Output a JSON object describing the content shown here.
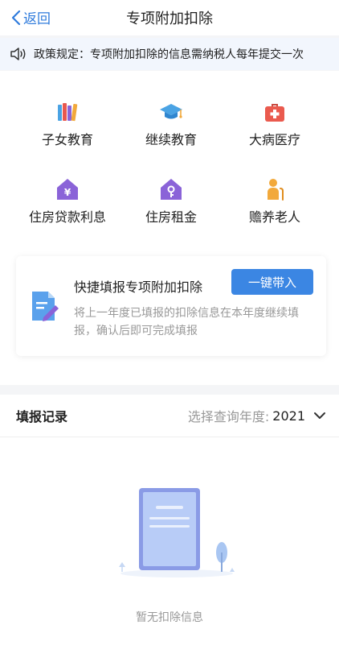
{
  "nav": {
    "back_label": "返回",
    "title": "专项附加扣除"
  },
  "notice": {
    "text": "政策规定：专项附加扣除的信息需纳税人每年提交一次",
    "icon": "speaker-icon"
  },
  "categories": [
    {
      "label": "子女教育",
      "icon": "books-icon",
      "color": "#e8584f"
    },
    {
      "label": "继续教育",
      "icon": "graduation-cap-icon",
      "color": "#4aa3e4"
    },
    {
      "label": "大病医疗",
      "icon": "medical-kit-icon",
      "color": "#ea5a4e"
    },
    {
      "label": "住房贷款利息",
      "icon": "house-yen-icon",
      "color": "#8a63d8"
    },
    {
      "label": "住房租金",
      "icon": "house-key-icon",
      "color": "#8a63d8"
    },
    {
      "label": "赡养老人",
      "icon": "elderly-icon",
      "color": "#f2a93b"
    }
  ],
  "quick_fill": {
    "title": "快捷填报专项附加扣除",
    "button_label": "一键带入",
    "description": "将上一年度已填报的扣除信息在本年度继续填报，确认后即可完成填报",
    "icon": "form-edit-icon"
  },
  "records": {
    "title": "填报记录",
    "year_label": "选择查询年度:",
    "year_value": "2021",
    "empty_text": "暂无扣除信息"
  },
  "colors": {
    "accent": "#3b86e3",
    "nav_link": "#2f7bdc",
    "notice_bg": "#f2f6fd"
  }
}
